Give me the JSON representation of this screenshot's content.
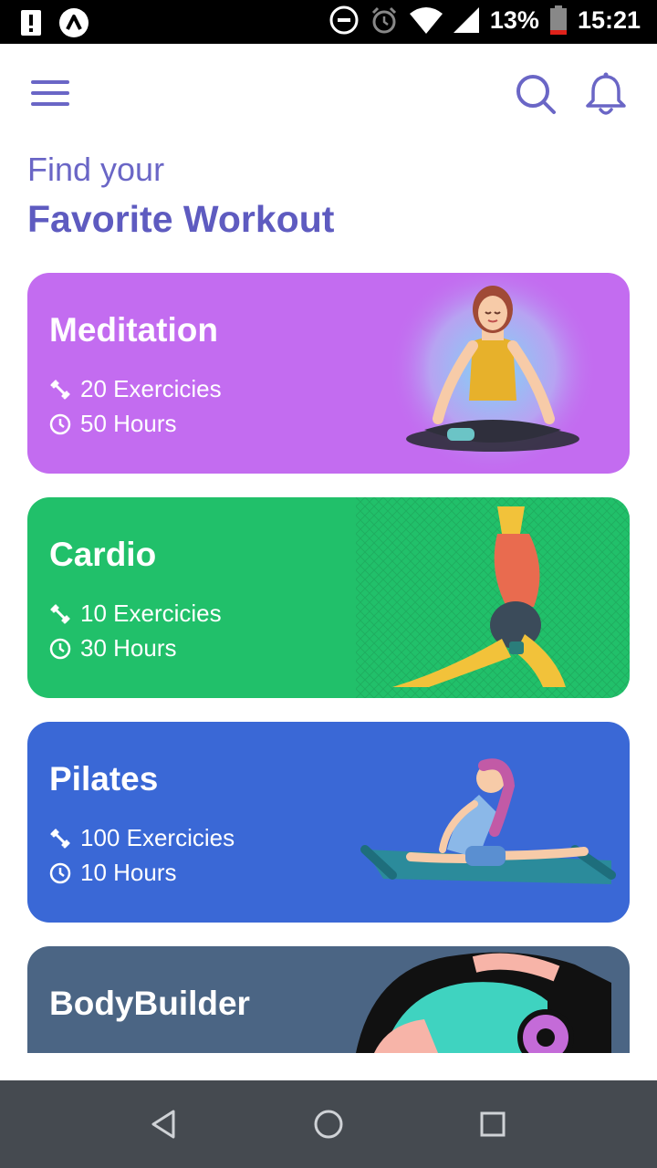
{
  "status_bar": {
    "battery": "13%",
    "time": "15:21",
    "icons": [
      "alert-icon",
      "app-logo-icon",
      "do-not-disturb-icon",
      "alarm-icon",
      "wifi-icon",
      "signal-icon",
      "battery-icon"
    ]
  },
  "app_bar": {
    "icons": [
      "menu-icon",
      "search-icon",
      "bell-icon"
    ],
    "accent": "#6a66c6"
  },
  "heading": {
    "sub": "Find your",
    "main": "Favorite Workout"
  },
  "cards": [
    {
      "title": "Meditation",
      "exercises": "20 Exercicies",
      "hours": "50 Hours",
      "color": "#c36cf0"
    },
    {
      "title": "Cardio",
      "exercises": "10 Exercicies",
      "hours": "30 Hours",
      "color": "#21c06a"
    },
    {
      "title": "Pilates",
      "exercises": "100 Exercicies",
      "hours": "10 Hours",
      "color": "#3a68d6"
    },
    {
      "title": "BodyBuilder",
      "color": "#4b6584"
    }
  ],
  "nav_bar": {
    "icons": [
      "back-icon",
      "home-icon",
      "recents-icon"
    ]
  }
}
